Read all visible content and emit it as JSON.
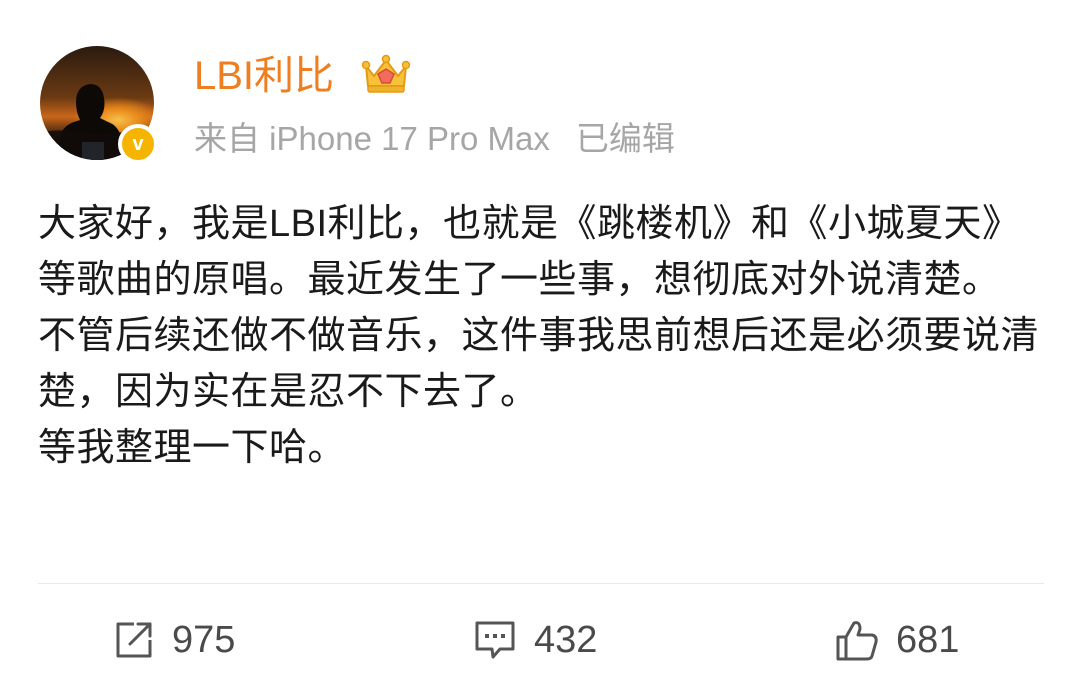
{
  "user": {
    "name": "LBI利比",
    "verified_badge": "v",
    "source": "来自 iPhone 17 Pro Max",
    "edited": "已编辑",
    "name_color": "#ee7e1f",
    "badge_color": "#f4b400"
  },
  "post": {
    "paragraphs": [
      "大家好，我是LBI利比，也就是《跳楼机》和《小城夏天》等歌曲的原唱。最近发生了一些事，想彻底对外说清楚。",
      "不管后续还做不做音乐，这件事我思前想后还是必须要说清楚，因为实在是忍不下去了。",
      "等我整理一下哈。"
    ]
  },
  "actions": {
    "repost": {
      "icon": "repost-icon",
      "count": "975"
    },
    "comment": {
      "icon": "comment-icon",
      "count": "432"
    },
    "like": {
      "icon": "thumbs-up-icon",
      "count": "681"
    }
  }
}
